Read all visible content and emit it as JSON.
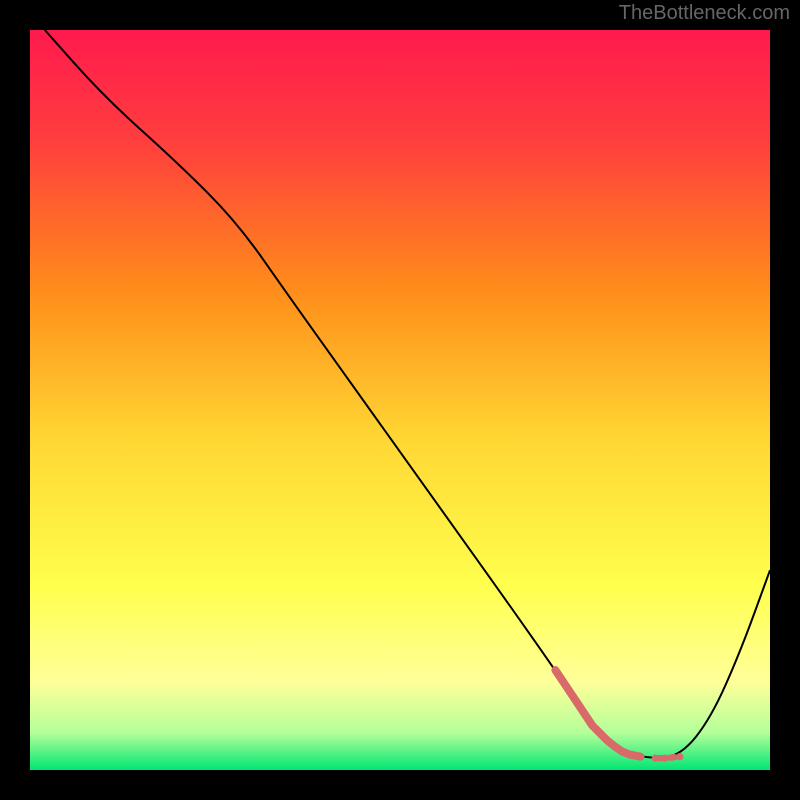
{
  "watermark": "TheBottleneck.com",
  "chart_data": {
    "type": "line",
    "title": "",
    "xlabel": "",
    "ylabel": "",
    "xlim": [
      0,
      100
    ],
    "ylim": [
      0,
      100
    ],
    "background_gradient": {
      "type": "vertical",
      "stops": [
        {
          "pos": 0.0,
          "color": "#ff1a4d"
        },
        {
          "pos": 0.15,
          "color": "#ff3e3e"
        },
        {
          "pos": 0.35,
          "color": "#ff8c1a"
        },
        {
          "pos": 0.55,
          "color": "#ffd633"
        },
        {
          "pos": 0.75,
          "color": "#ffff4d"
        },
        {
          "pos": 0.88,
          "color": "#ffff99"
        },
        {
          "pos": 0.95,
          "color": "#b3ff99"
        },
        {
          "pos": 1.0,
          "color": "#00e673"
        }
      ]
    },
    "series": [
      {
        "name": "bottleneck-curve",
        "color": "#000000",
        "stroke_width": 2,
        "x": [
          2,
          10,
          20,
          28,
          35,
          45,
          55,
          65,
          72,
          76,
          80,
          84,
          88,
          92,
          96,
          100
        ],
        "y": [
          100,
          91,
          82,
          74,
          64,
          50,
          36,
          22,
          12,
          6,
          2.5,
          1.5,
          2,
          7,
          16,
          27
        ]
      }
    ],
    "markers": {
      "name": "highlight-region",
      "color": "#d96a6a",
      "stroke_width": 8,
      "points": [
        {
          "x": 71,
          "y": 13.5
        },
        {
          "x": 72,
          "y": 12
        },
        {
          "x": 73,
          "y": 10.5
        },
        {
          "x": 74,
          "y": 9
        },
        {
          "x": 75,
          "y": 7.5
        },
        {
          "x": 76,
          "y": 6
        },
        {
          "x": 77,
          "y": 5
        },
        {
          "x": 78,
          "y": 4
        },
        {
          "x": 79,
          "y": 3.2
        },
        {
          "x": 80,
          "y": 2.5
        },
        {
          "x": 81,
          "y": 2.1
        },
        {
          "x": 82.5,
          "y": 1.8
        },
        {
          "x": 84.5,
          "y": 1.6
        },
        {
          "x": 85.8,
          "y": 1.6
        },
        {
          "x": 87.8,
          "y": 1.8
        }
      ]
    }
  }
}
